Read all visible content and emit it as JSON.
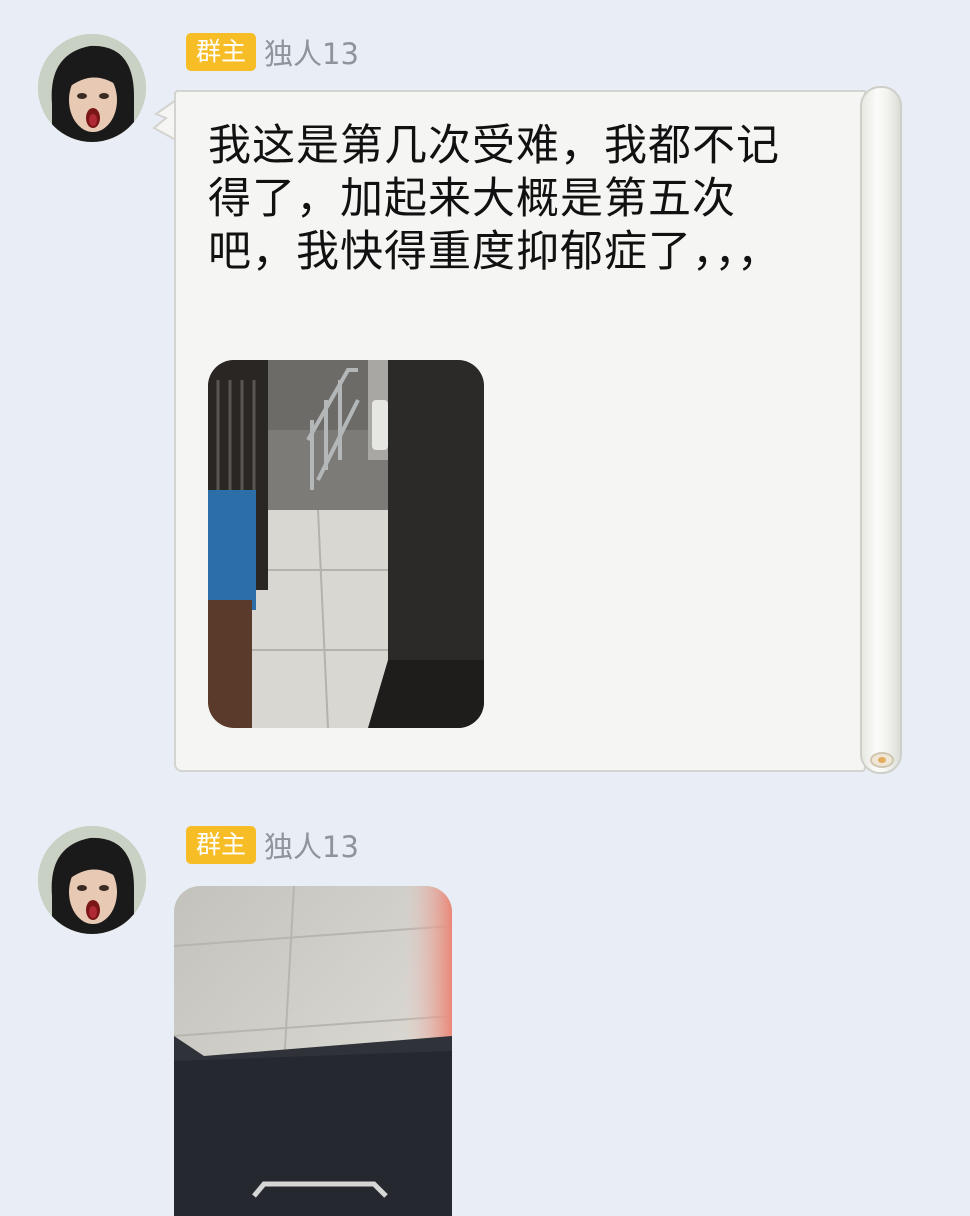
{
  "messages": [
    {
      "badge": "群主",
      "sender": "独人13",
      "text": "我这是第几次受难，我都不记得了，加起来大概是第五次吧，我快得重度抑郁症了，，，",
      "image": "photo-doorway"
    },
    {
      "badge": "群主",
      "sender": "独人13",
      "image": "photo-floor"
    }
  ],
  "colors": {
    "background": "#e9edf5",
    "badge": "#f6bd26",
    "nickname": "#8e939c",
    "bubble": "#f5f5f3"
  }
}
